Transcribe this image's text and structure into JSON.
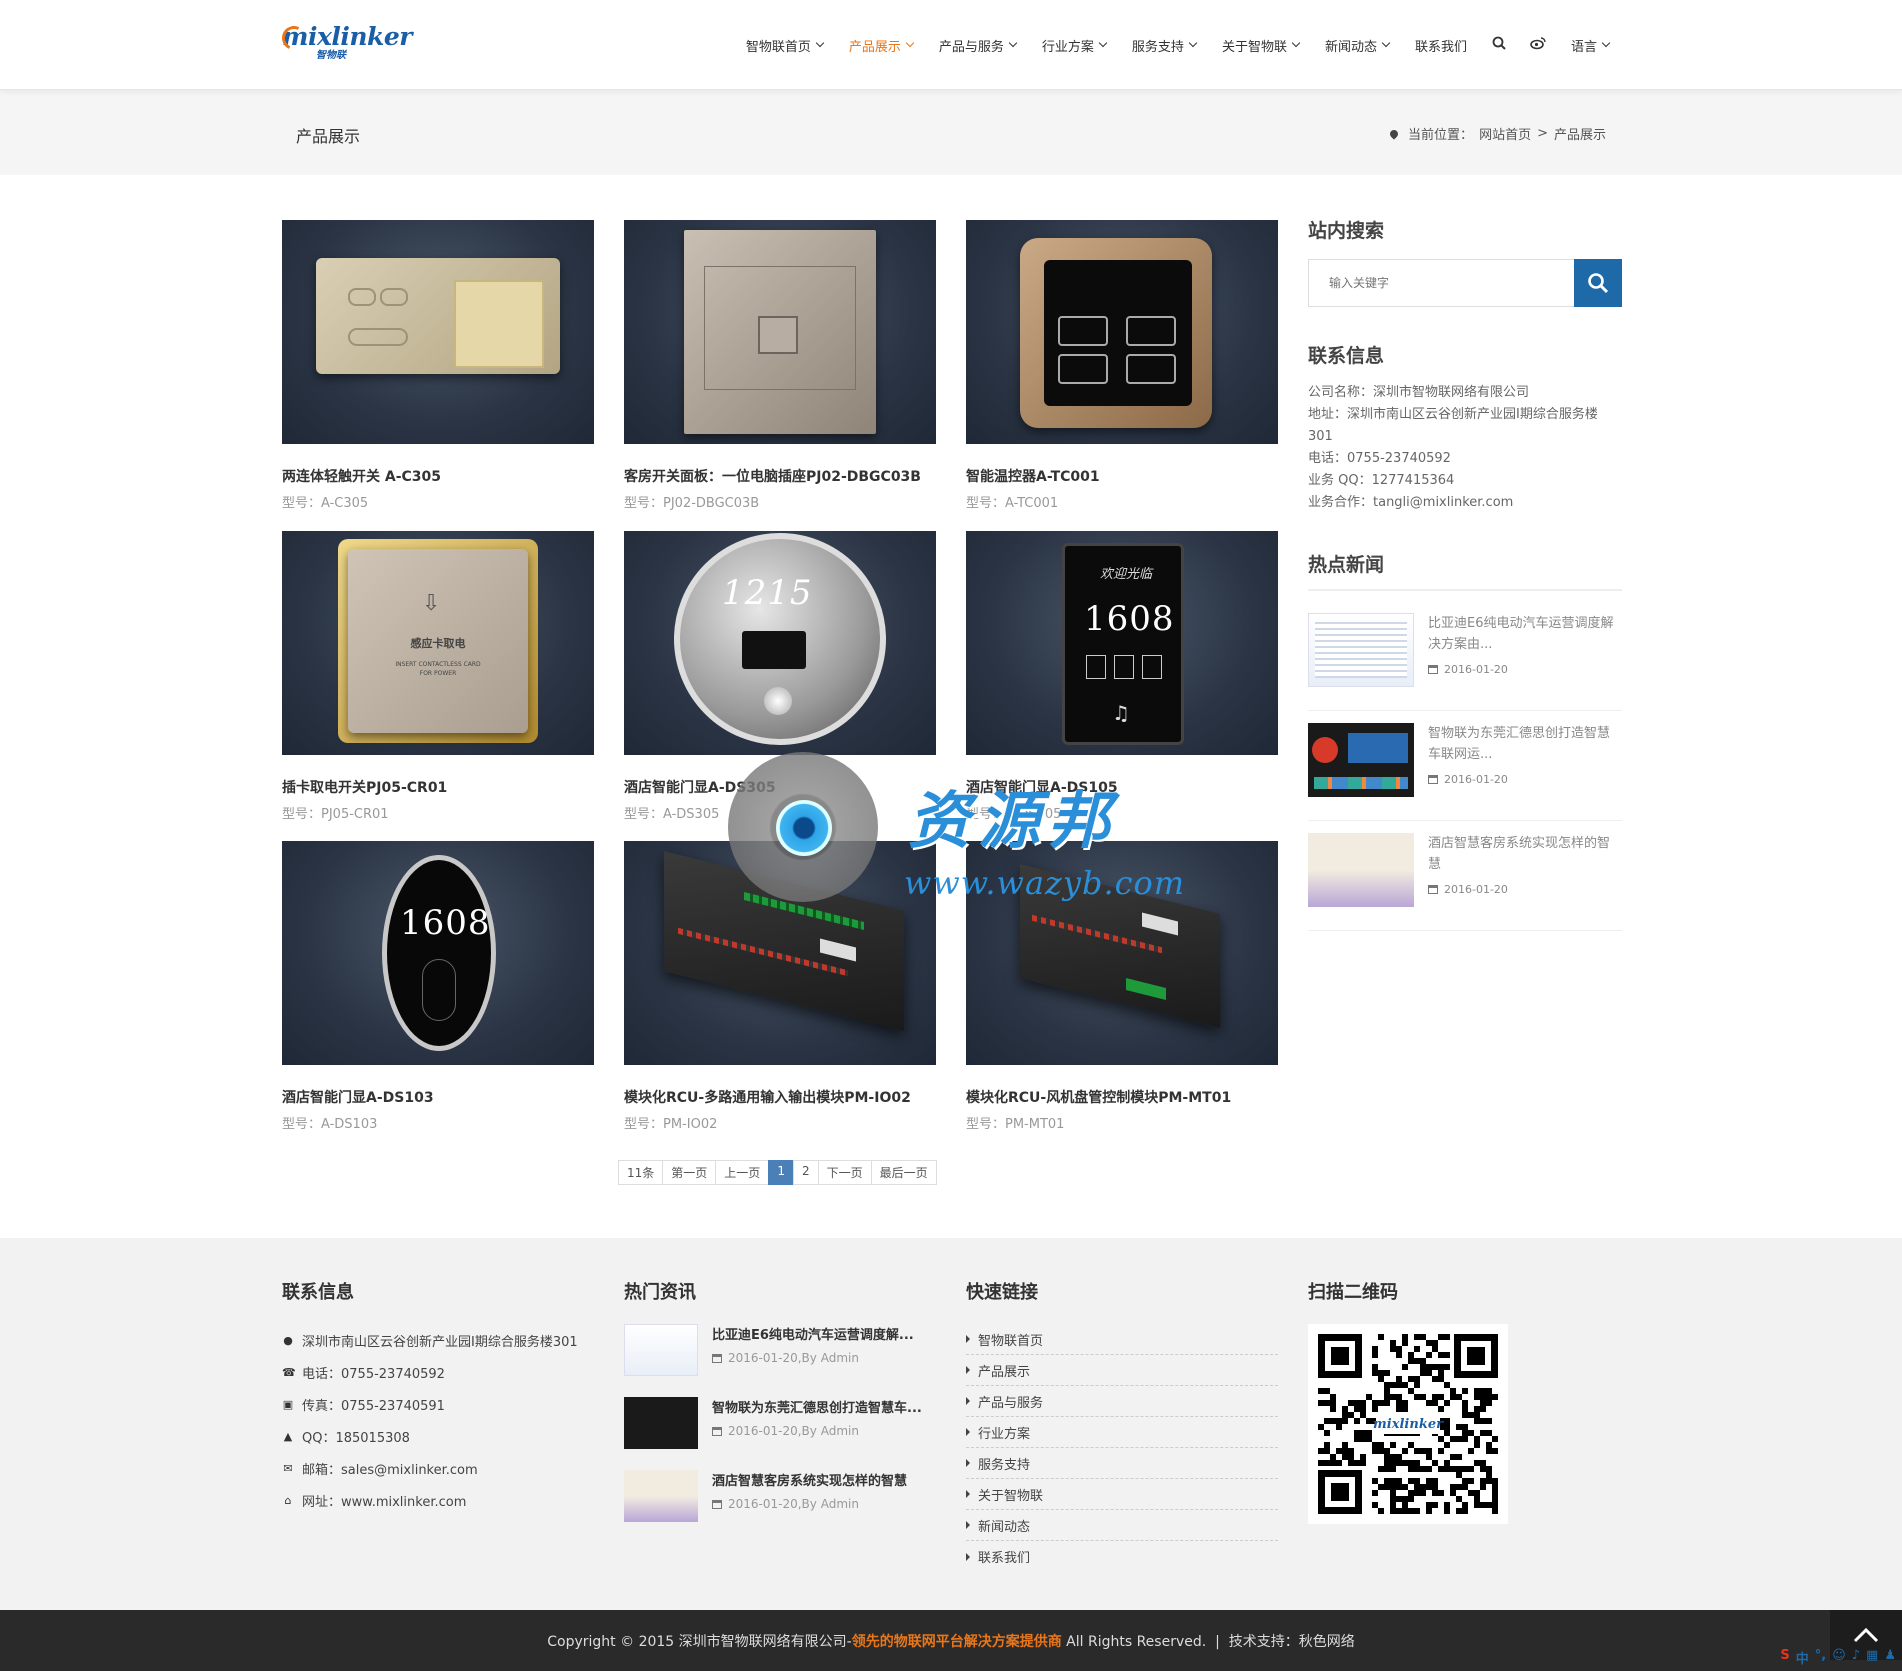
{
  "header": {
    "logo_text": "mixlinker",
    "logo_cn": "智物联",
    "nav": [
      {
        "label": "智物联首页"
      },
      {
        "label": "产品展示"
      },
      {
        "label": "产品与服务"
      },
      {
        "label": "行业方案"
      },
      {
        "label": "服务支持"
      },
      {
        "label": "关于智物联"
      },
      {
        "label": "新闻动态"
      },
      {
        "label": "联系我们"
      }
    ],
    "lang_label": "语言"
  },
  "titlebar": {
    "title": "产品展示",
    "breadcrumb_prefix": "当前位置：",
    "crumb_home": "网站首页",
    "crumb_sep": ">",
    "crumb_current": "产品展示"
  },
  "products": [
    {
      "name": "两连体轻触开关 A-C305",
      "model": "型号：A-C305"
    },
    {
      "name": "客房开关面板：一位电脑插座PJ02-DBGC03B",
      "model": "型号：PJ02-DBGC03B"
    },
    {
      "name": "智能温控器A-TC001",
      "model": "型号：A-TC001"
    },
    {
      "name": "插卡取电开关PJ05-CR01",
      "model": "型号：PJ05-CR01"
    },
    {
      "name": "酒店智能门显A-DS305",
      "model": "型号：A-DS305"
    },
    {
      "name": "酒店智能门显A-DS105",
      "model": "型号：A-DS105"
    },
    {
      "name": "酒店智能门显A-DS103",
      "model": "型号：A-DS103"
    },
    {
      "name": "模块化RCU-多路通用输入输出模块PM-IO02",
      "model": "型号：PM-IO02"
    },
    {
      "name": "模块化RCU-风机盘管控制模块PM-MT01",
      "model": "型号：PM-MT01"
    }
  ],
  "product_image_text": {
    "card_reader_cn": "感应卡取电",
    "card_reader_en1": "INSERT CONTACTLESS CARD",
    "card_reader_en2": "FOR POWER",
    "ds305_num": "1215",
    "ds105_num": "1608",
    "ds105_welcome": "欢迎光临",
    "ds103_num": "1608"
  },
  "pagination": {
    "count": "11条",
    "first": "第一页",
    "prev": "上一页",
    "current": "1",
    "page2": "2",
    "next": "下一页",
    "last": "最后一页"
  },
  "sidebar": {
    "search_heading": "站内搜索",
    "search_placeholder": "输入关键字",
    "contact_heading": "联系信息",
    "contact": [
      "公司名称：深圳市智物联网络有限公司",
      "地址：深圳市南山区云谷创新产业园Ⅰ期综合服务楼301",
      "电话：0755-23740592",
      "业务 QQ：1277415364",
      "业务合作：tangli@mixlinker.com"
    ],
    "hot_heading": "热点新闻",
    "hot_news": [
      {
        "title": "比亚迪E6纯电动汽车运营调度解决方案由...",
        "date": "2016-01-20"
      },
      {
        "title": "智物联为东莞汇德思创打造智慧车联网运...",
        "date": "2016-01-20"
      },
      {
        "title": "酒店智慧客房系统实现怎样的智慧",
        "date": "2016-01-20"
      }
    ]
  },
  "watermark": {
    "text": "资源邦",
    "url": "www.wazyb.com"
  },
  "footer": {
    "contact_heading": "联系信息",
    "contact": [
      {
        "icon": "location-icon",
        "text": "深圳市南山区云谷创新产业园Ⅰ期综合服务楼301"
      },
      {
        "icon": "phone-icon",
        "text": "电话：0755-23740592"
      },
      {
        "icon": "fax-icon",
        "text": "传真：0755-23740591"
      },
      {
        "icon": "qq-icon",
        "text": "QQ：185015308"
      },
      {
        "icon": "mail-icon",
        "text": "邮箱：sales@mixlinker.com"
      },
      {
        "icon": "home-icon",
        "text": "网址：www.mixlinker.com"
      }
    ],
    "news_heading": "热门资讯",
    "news": [
      {
        "title": "比亚迪E6纯电动汽车运营调度解...",
        "meta": "2016-01-20,By Admin"
      },
      {
        "title": "智物联为东莞汇德思创打造智慧车...",
        "meta": "2016-01-20,By Admin"
      },
      {
        "title": "酒店智慧客房系统实现怎样的智慧",
        "meta": "2016-01-20,By Admin"
      }
    ],
    "links_heading": "快速链接",
    "links": [
      "智物联首页",
      "产品展示",
      "产品与服务",
      "行业方案",
      "服务支持",
      "关于智物联",
      "新闻动态",
      "联系我们"
    ],
    "qr_heading": "扫描二维码",
    "qr_logo": "mixlinker"
  },
  "copyright": {
    "prefix": "Copyright © 2015 深圳市智物联网络有限公司-",
    "highlight": "领先的物联网平台解决方案提供商",
    "suffix": " All Rights Reserved.  |  技术支持：",
    "support": "秋色网络"
  },
  "ime": {
    "s": "S",
    "cn": "中"
  },
  "colors": {
    "accent": "#e8761b",
    "brand_blue": "#1e6aa8",
    "pager_active": "#4a7fb8"
  }
}
